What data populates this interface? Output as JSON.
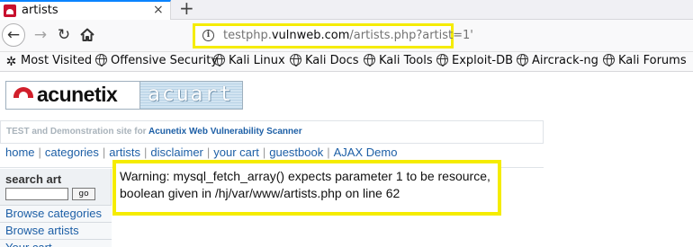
{
  "tab": {
    "title": "artists",
    "close": "×"
  },
  "newtab": "+",
  "nav": {
    "back": "←",
    "forward": "→",
    "reload": "↻"
  },
  "url": {
    "scheme_host_prefix": "testphp.",
    "domain": "vulnweb.com",
    "path": "/artists.php?artist=1'"
  },
  "bookmarks": [
    {
      "label": "Most Visited",
      "icon": "gear-icon"
    },
    {
      "label": "Offensive Security",
      "icon": "globe-icon"
    },
    {
      "label": "Kali Linux",
      "icon": "globe-icon"
    },
    {
      "label": "Kali Docs",
      "icon": "globe-icon"
    },
    {
      "label": "Kali Tools",
      "icon": "globe-icon"
    },
    {
      "label": "Exploit-DB",
      "icon": "globe-icon"
    },
    {
      "label": "Aircrack-ng",
      "icon": "globe-icon"
    },
    {
      "label": "Kali Forums",
      "icon": "globe-icon"
    }
  ],
  "logo": {
    "left": "acunetix",
    "right": "acuart"
  },
  "tagline": {
    "prefix": "TEST and Demonstration site for ",
    "link": "Acunetix Web Vulnerability Scanner"
  },
  "menu": [
    "home",
    "categories",
    "artists",
    "disclaimer",
    "your cart",
    "guestbook",
    "AJAX Demo"
  ],
  "sidebar": {
    "search_title": "search art",
    "go_label": "go",
    "links": [
      "Browse categories",
      "Browse artists",
      "Your cart"
    ]
  },
  "warning": "Warning: mysql_fetch_array() expects parameter 1 to be resource, boolean given in /hj/var/www/artists.php on line 62",
  "colors": {
    "highlight": "#f5ec00",
    "link": "#1d5fa6",
    "brand_red": "#d11f2b"
  }
}
